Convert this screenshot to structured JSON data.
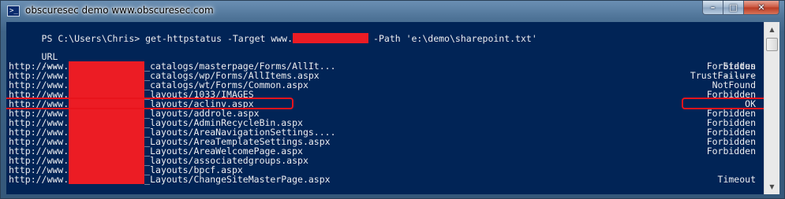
{
  "window": {
    "title": "obscuresec demo www.obscuresec.com",
    "icon": "powershell-icon",
    "buttons": {
      "minimize": "minimize-icon",
      "maximize": "maximize-icon",
      "close": "close-icon"
    }
  },
  "console": {
    "prompt_prefix": "PS C:\\Users\\Chris> get-httpstatus -Target www.",
    "prompt_suffix": "-Path 'e:\\demo\\sharepoint.txt'",
    "header_url": "URL",
    "header_status": "Status",
    "underline_url": "---",
    "underline_status": "------",
    "url_prefix": "http://www.",
    "rows": [
      {
        "path": "_catalogs/masterpage/Forms/AllIt...",
        "status": "Forbidden"
      },
      {
        "path": "_catalogs/wp/Forms/AllItems.aspx",
        "status": "TrustFailure"
      },
      {
        "path": "_catalogs/wt/Forms/Common.aspx",
        "status": "NotFound"
      },
      {
        "path": "_layouts/1033/IMAGES",
        "status": "Forbidden"
      },
      {
        "path": "_layouts/aclinv.aspx",
        "status": "OK"
      },
      {
        "path": "_layouts/addrole.aspx",
        "status": "Forbidden"
      },
      {
        "path": "_layouts/AdminRecycleBin.aspx",
        "status": "Forbidden"
      },
      {
        "path": "_layouts/AreaNavigationSettings....",
        "status": "Forbidden"
      },
      {
        "path": "_Layouts/AreaTemplateSettings.aspx",
        "status": "Forbidden"
      },
      {
        "path": "_Layouts/AreaWelcomePage.aspx",
        "status": "Forbidden"
      },
      {
        "path": "_layouts/associatedgroups.aspx",
        "status": ""
      },
      {
        "path": "_layouts/bpcf.aspx",
        "status": ""
      },
      {
        "path": "_Layouts/ChangeSiteMasterPage.aspx",
        "status": "Timeout"
      }
    ]
  },
  "colors": {
    "console_bg": "#012456",
    "console_text": "#eeedf0",
    "redaction": "#ec1c24",
    "highlight": "#e8141c"
  }
}
